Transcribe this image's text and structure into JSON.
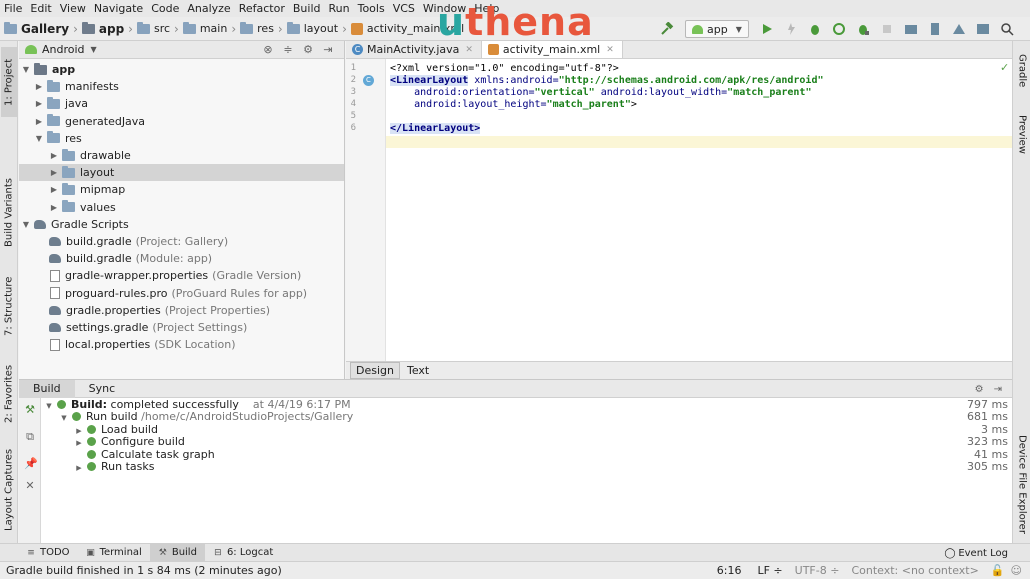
{
  "menu": [
    "File",
    "Edit",
    "View",
    "Navigate",
    "Code",
    "Analyze",
    "Refactor",
    "Build",
    "Run",
    "Tools",
    "VCS",
    "Window",
    "Help"
  ],
  "breadcrumbs": [
    "Gallery",
    "app",
    "src",
    "main",
    "res",
    "layout",
    "activity_main.xml"
  ],
  "logo": {
    "first": "u",
    "rest": "thena"
  },
  "run_config": "app",
  "left_tabs": {
    "project": "1: Project",
    "build_variants": "Build Variants",
    "structure": "7: Structure",
    "favorites": "2: Favorites",
    "layout_captures": "Layout Captures"
  },
  "right_tabs": {
    "gradle": "Gradle",
    "preview": "Preview",
    "device_file_explorer": "Device File Explorer"
  },
  "project": {
    "view": "Android",
    "tree": [
      {
        "label": "app",
        "note": "",
        "bold": true
      },
      {
        "label": "manifests",
        "note": ""
      },
      {
        "label": "java",
        "note": ""
      },
      {
        "label": "generatedJava",
        "note": ""
      },
      {
        "label": "res",
        "note": ""
      },
      {
        "label": "drawable",
        "note": ""
      },
      {
        "label": "layout",
        "note": ""
      },
      {
        "label": "mipmap",
        "note": ""
      },
      {
        "label": "values",
        "note": ""
      },
      {
        "label": "Gradle Scripts",
        "note": ""
      },
      {
        "label": "build.gradle",
        "note": "(Project: Gallery)"
      },
      {
        "label": "build.gradle",
        "note": "(Module: app)"
      },
      {
        "label": "gradle-wrapper.properties",
        "note": "(Gradle Version)"
      },
      {
        "label": "proguard-rules.pro",
        "note": "(ProGuard Rules for app)"
      },
      {
        "label": "gradle.properties",
        "note": "(Project Properties)"
      },
      {
        "label": "settings.gradle",
        "note": "(Project Settings)"
      },
      {
        "label": "local.properties",
        "note": "(SDK Location)"
      }
    ]
  },
  "editor": {
    "tabs": [
      "MainActivity.java",
      "activity_main.xml"
    ],
    "line_numbers": [
      "1",
      "2",
      "3",
      "4",
      "5",
      "6"
    ],
    "code": {
      "l1": "<?xml version=\"1.0\" encoding=\"utf-8\"?>",
      "l2_tag": "<LinearLayout",
      "l2_attr": " xmlns:android=",
      "l2_val": "\"http://schemas.android.com/apk/res/android\"",
      "l3_attr1": "    android:orientation=",
      "l3_val1": "\"vertical\"",
      "l3_attr2": " android:layout_width=",
      "l3_val2": "\"match_parent\"",
      "l4_attr": "    android:layout_height=",
      "l4_val": "\"match_parent\"",
      "l4_end": ">",
      "l6_tag": "</LinearLayout>"
    },
    "design_tabs": [
      "Design",
      "Text"
    ]
  },
  "build": {
    "tabs": [
      "Build",
      "Sync"
    ],
    "rows": [
      {
        "label": "Build:",
        "rest": "completed successfully",
        "time": "at 4/4/19 6:17 PM",
        "ms": "797 ms"
      },
      {
        "label": "Run build",
        "rest": "/home/c/AndroidStudioProjects/Gallery",
        "time": "",
        "ms": "681 ms"
      },
      {
        "label": "Load build",
        "rest": "",
        "time": "",
        "ms": "3 ms"
      },
      {
        "label": "Configure build",
        "rest": "",
        "time": "",
        "ms": "323 ms"
      },
      {
        "label": "Calculate task graph",
        "rest": "",
        "time": "",
        "ms": "41 ms"
      },
      {
        "label": "Run tasks",
        "rest": "",
        "time": "",
        "ms": "305 ms"
      }
    ]
  },
  "toolwindows": {
    "todo": "TODO",
    "terminal": "Terminal",
    "build": "Build",
    "logcat": "6: Logcat",
    "eventlog": "Event Log"
  },
  "status": {
    "message": "Gradle build finished in 1 s 84 ms (2 minutes ago)",
    "position": "6:16",
    "line_sep": "LF ÷",
    "encoding": "UTF-8 ÷",
    "context": "Context: <no context>"
  }
}
